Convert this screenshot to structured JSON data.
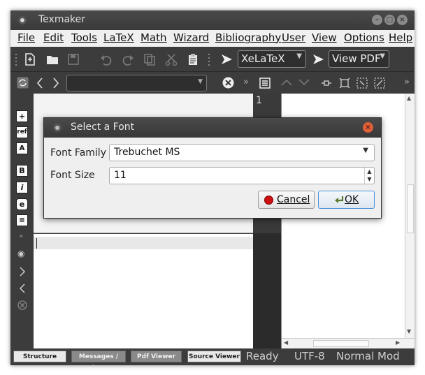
{
  "window": {
    "title": "Texmaker"
  },
  "menu": [
    "File",
    "Edit",
    "Tools",
    "LaTeX",
    "Math",
    "Wizard",
    "Bibliography",
    "User",
    "View",
    "Options",
    "Help"
  ],
  "toolbar": {
    "compiler": "XeLaTeX",
    "viewer": "View PDF"
  },
  "gutter": {
    "line_number": "1"
  },
  "sidebar": {
    "icons": [
      "insert-icon",
      "ref-icon",
      "font-size-icon",
      "bold-icon",
      "italic-icon",
      "emphasis-icon",
      "align-icon"
    ]
  },
  "statusbar": {
    "buttons": [
      "Structure",
      "Messages / Log",
      "Pdf Viewer",
      "Source Viewer"
    ],
    "status": "Ready",
    "encoding": "UTF-8",
    "mode": "Normal Mod"
  },
  "dialog": {
    "title": "Select a Font",
    "font_family_label": "Font Family",
    "font_family_value": "Trebuchet MS",
    "font_size_label": "Font Size",
    "font_size_value": "11",
    "cancel_label": "Cancel",
    "ok_label": "OK"
  },
  "colors": {
    "chrome": "#3c3c3c",
    "menubar": "#f0f0f0",
    "close": "#e0603a",
    "ok_border": "#4a90d9"
  }
}
